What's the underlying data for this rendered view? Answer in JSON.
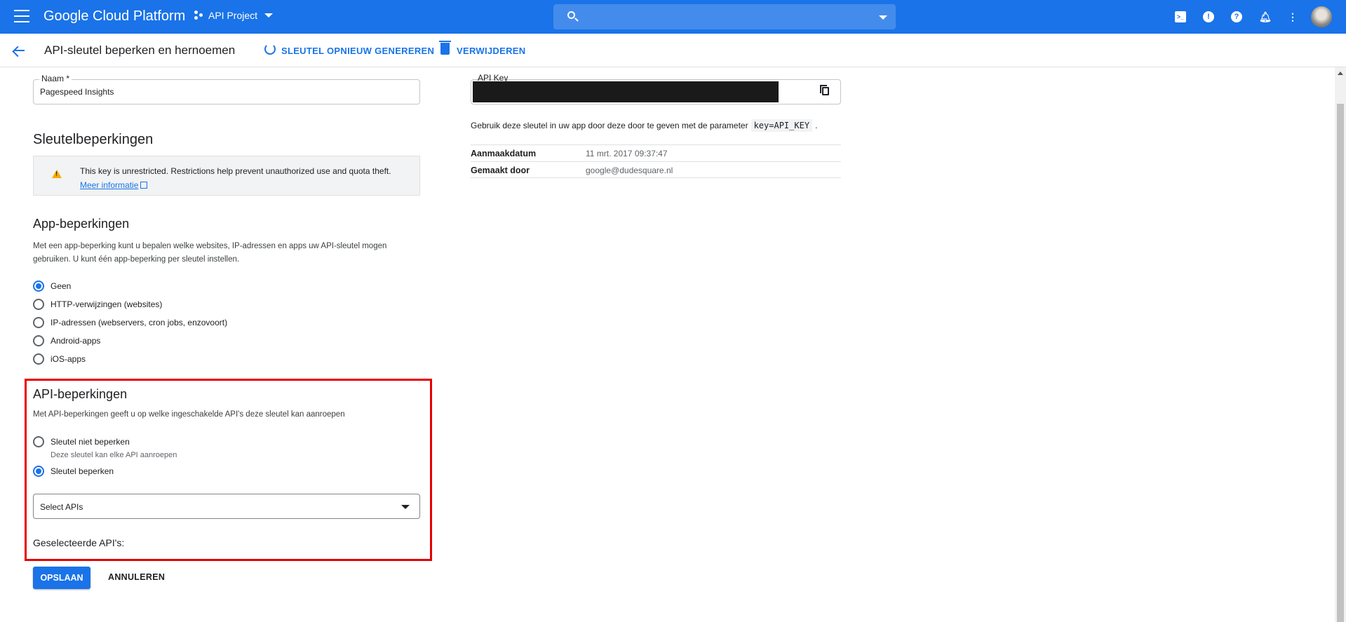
{
  "header": {
    "brand": "Google Cloud Platform",
    "project": "API Project",
    "search_placeholder": ""
  },
  "subbar": {
    "title": "API-sleutel beperken en hernoemen",
    "regenerate_label": "SLEUTEL OPNIEUW GENEREREN",
    "delete_label": "VERWIJDEREN"
  },
  "name_field": {
    "label": "Naam *",
    "value": "Pagespeed Insights"
  },
  "key_restrictions": {
    "title": "Sleutelbeperkingen",
    "warning_text": "This key is unrestricted. Restrictions help prevent unauthorized use and quota theft.",
    "warning_link": "Meer informatie"
  },
  "app_restrictions": {
    "title": "App-beperkingen",
    "description": "Met een app-beperking kunt u bepalen welke websites, IP-adressen en apps uw API-sleutel mogen gebruiken. U kunt één app-beperking per sleutel instellen.",
    "options": [
      {
        "label": "Geen",
        "checked": true
      },
      {
        "label": "HTTP-verwijzingen (websites)",
        "checked": false
      },
      {
        "label": "IP-adressen (webservers, cron jobs, enzovoort)",
        "checked": false
      },
      {
        "label": "Android-apps",
        "checked": false
      },
      {
        "label": "iOS-apps",
        "checked": false
      }
    ]
  },
  "api_restrictions": {
    "title": "API-beperkingen",
    "description": "Met API-beperkingen geeft u op welke ingeschakelde API's deze sleutel kan aanroepen",
    "options": [
      {
        "label": "Sleutel niet beperken",
        "sublabel": "Deze sleutel kan elke API aanroepen",
        "checked": false
      },
      {
        "label": "Sleutel beperken",
        "checked": true
      }
    ],
    "select_value": "Select APIs",
    "selected_title": "Geselecteerde API's:"
  },
  "buttons": {
    "save": "OPSLAAN",
    "cancel": "ANNULEREN"
  },
  "api_key_panel": {
    "label": "API Key",
    "usage_prefix": "Gebruik deze sleutel in uw app door deze door te geven met de parameter",
    "usage_code": "key=API_KEY",
    "usage_suffix": ".",
    "rows": [
      {
        "key": "Aanmaakdatum",
        "value": "11 mrt. 2017 09:37:47"
      },
      {
        "key": "Gemaakt door",
        "value": "google@dudesquare.nl"
      }
    ]
  },
  "icons": {
    "menu": "hamburger-icon",
    "search": "search-icon",
    "terminal": "terminal-icon",
    "feedback": "feedback-icon",
    "help": "help-icon",
    "notifications": "bell-icon",
    "more": "more-vert-icon"
  },
  "colors": {
    "primary": "#1a73e8",
    "highlight_border": "#e60000",
    "warning": "#f9ab00"
  }
}
